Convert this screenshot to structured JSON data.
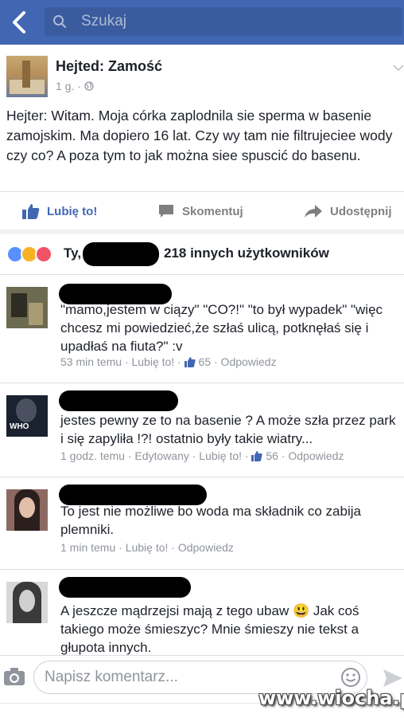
{
  "search": {
    "placeholder": "Szukaj"
  },
  "post": {
    "group": "Hejted: Zamość",
    "time": "1 g. ·",
    "text": "Hejter: Witam. Moja córka zaplodnila sie sperma w basenie zamojskim. Ma dopiero 16 lat. Czy wy tam nie filtrujeciee wody czy co? A poza tym to jak można siee spuscić do basenu.",
    "actions": {
      "like": "Lubię to!",
      "comment": "Skomentuj",
      "share": "Udostępnij"
    },
    "reactions": {
      "prefix": "Ty,",
      "others": "218 innych użytkowników"
    }
  },
  "comments": [
    {
      "text": "\"mamo,jestem w ciązy\" \"CO?!\" \"to był wypadek\" \"więc chcesz mi powiedzieć,że szłaś ulicą, potknęłaś się i upadłaś na fiuta?\" :v",
      "meta_pre": "53 min temu · Lubię to! · ",
      "likes": "65",
      "meta_post": " · Odpowiedz"
    },
    {
      "text": "jestes pewny ze to na basenie ? A może szła przez park i się zapyliła !?! ostatnio były takie wiatry...",
      "meta_pre": "1 godz. temu · Edytowany · Lubię to! · ",
      "likes": "56",
      "meta_post": " · Odpowiedz"
    },
    {
      "text": "To jest nie możliwe bo woda ma składnik co zabija plemniki.",
      "meta": "1 min temu · Lubię to! · Odpowiedz"
    },
    {
      "text": "A jeszcze mądrzejsi mają z tego ubaw 😃 Jak coś takiego może śmieszyc? Mnie śmieszy nie tekst a głupota innych."
    }
  ],
  "composer": {
    "placeholder": "Napisz komentarz..."
  },
  "watermark": "www.wiocha.pl",
  "colors": {
    "fb_blue": "#4267b2",
    "meta_gray": "#90949c"
  }
}
